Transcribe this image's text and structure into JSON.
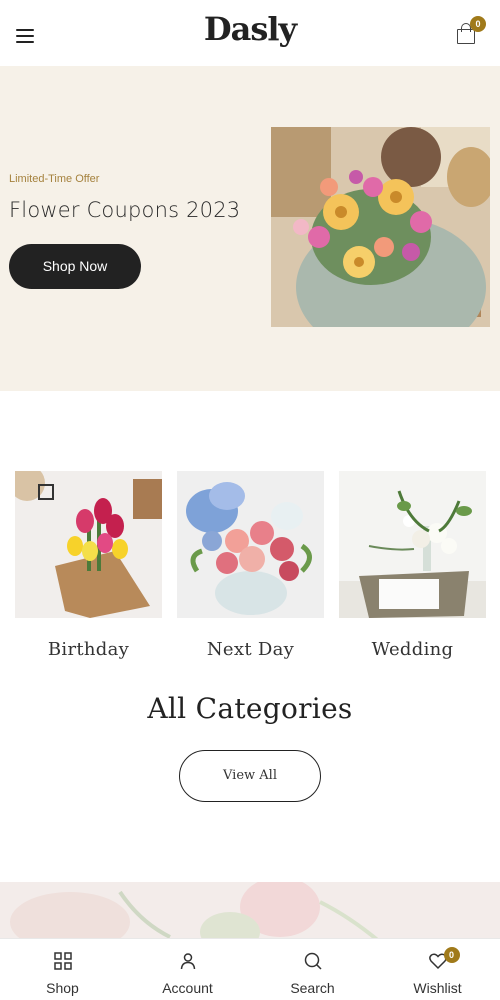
{
  "header": {
    "logo": "Dasly",
    "cart_count": "0"
  },
  "hero": {
    "tag": "Limited-Time Offer",
    "title": "Flower Coupons 2023",
    "button_label": "Shop Now"
  },
  "categories": [
    {
      "label": "Birthday"
    },
    {
      "label": "Next Day"
    },
    {
      "label": "Wedding"
    }
  ],
  "all_categories": {
    "title": "All Categories",
    "button_label": "View All"
  },
  "bottom_nav": [
    {
      "label": "Shop",
      "icon": "grid-icon"
    },
    {
      "label": "Account",
      "icon": "user-icon"
    },
    {
      "label": "Search",
      "icon": "search-icon"
    },
    {
      "label": "Wishlist",
      "icon": "heart-icon",
      "count": "0"
    }
  ],
  "colors": {
    "accent": "#a07a1a",
    "hero_bg": "#f6f1e8",
    "button_dark": "#222222"
  }
}
